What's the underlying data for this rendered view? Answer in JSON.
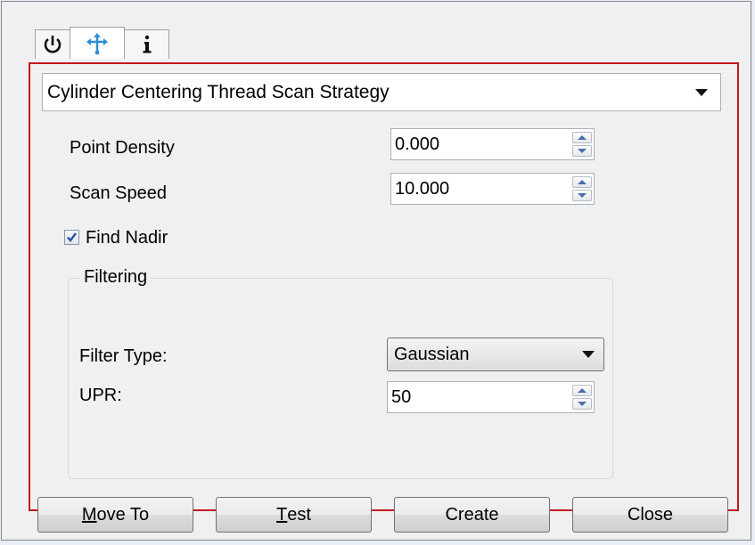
{
  "tabs": [
    {
      "icon": "power-icon"
    },
    {
      "icon": "probe-axes-icon",
      "active": true
    },
    {
      "icon": "info-icon"
    }
  ],
  "strategy": {
    "selected": "Cylinder Centering Thread Scan Strategy"
  },
  "fields": {
    "point_density": {
      "label": "Point Density",
      "value": "0.000"
    },
    "scan_speed": {
      "label": "Scan Speed",
      "value": "10.000"
    },
    "find_nadir": {
      "label": "Find Nadir",
      "checked": true
    }
  },
  "filtering": {
    "title": "Filtering",
    "filter_type": {
      "label": "Filter Type:",
      "value": "Gaussian"
    },
    "upr": {
      "label": "UPR:",
      "value": "50"
    }
  },
  "buttons": {
    "move_to": {
      "accel": "M",
      "rest": "ove To"
    },
    "test": {
      "accel": "T",
      "rest": "est"
    },
    "create": {
      "label": "Create"
    },
    "close": {
      "label": "Close"
    }
  },
  "colors": {
    "highlight_border": "#c4161c",
    "accent_icon": "#2a8fd6"
  }
}
